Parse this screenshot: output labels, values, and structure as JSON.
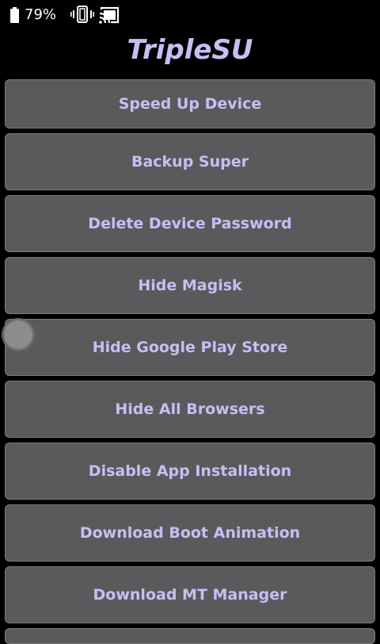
{
  "status_bar": {
    "battery_percent": "79%",
    "icons": [
      "battery-icon",
      "vibrate-icon",
      "cast-icon"
    ]
  },
  "app": {
    "title": "TripleSU"
  },
  "buttons": [
    {
      "label": "Speed Up Device"
    },
    {
      "label": "Backup Super"
    },
    {
      "label": "Delete Device Password"
    },
    {
      "label": "Hide Magisk"
    },
    {
      "label": "Hide Google Play Store"
    },
    {
      "label": "Hide All Browsers"
    },
    {
      "label": "Disable App Installation"
    },
    {
      "label": "Download Boot Animation"
    },
    {
      "label": "Download MT Manager"
    }
  ],
  "colors": {
    "background": "#000000",
    "button_bg": "#5a5a5c",
    "button_text": "#c4c0f4",
    "title_text": "#c4c0f4"
  }
}
